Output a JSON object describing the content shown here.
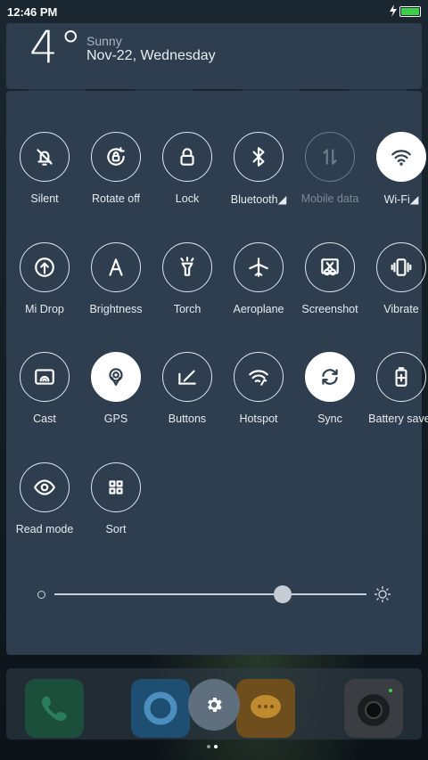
{
  "status": {
    "time": "12:46 PM",
    "battery_color": "#3ecf4a"
  },
  "weather": {
    "temp": "4°",
    "condition": "Sunny",
    "date": "Nov-22, Wednesday"
  },
  "toggles": [
    {
      "label": "Silent",
      "icon": "bell-off-icon",
      "state": "off"
    },
    {
      "label": "Rotate off",
      "icon": "rotate-lock-icon",
      "state": "off"
    },
    {
      "label": "Lock",
      "icon": "lock-icon",
      "state": "off"
    },
    {
      "label": "Bluetooth◢",
      "icon": "bluetooth-icon",
      "state": "off"
    },
    {
      "label": "Mobile data",
      "icon": "mobile-data-icon",
      "state": "disabled"
    },
    {
      "label": "Wi-Fi◢",
      "icon": "wifi-icon",
      "state": "on"
    },
    {
      "label": "Mi Drop",
      "icon": "mi-drop-icon",
      "state": "off"
    },
    {
      "label": "Brightness",
      "icon": "brightness-icon",
      "state": "off"
    },
    {
      "label": "Torch",
      "icon": "torch-icon",
      "state": "off"
    },
    {
      "label": "Aeroplane",
      "icon": "airplane-icon",
      "state": "off"
    },
    {
      "label": "Screenshot",
      "icon": "scissors-icon",
      "state": "off"
    },
    {
      "label": "Vibrate",
      "icon": "vibrate-icon",
      "state": "off"
    },
    {
      "label": "Cast",
      "icon": "cast-icon",
      "state": "off"
    },
    {
      "label": "GPS",
      "icon": "gps-icon",
      "state": "on"
    },
    {
      "label": "Buttons",
      "icon": "buttons-icon",
      "state": "off"
    },
    {
      "label": "Hotspot",
      "icon": "hotspot-icon",
      "state": "off"
    },
    {
      "label": "Sync",
      "icon": "sync-icon",
      "state": "on"
    },
    {
      "label": "Battery saver",
      "icon": "battery-saver-icon",
      "state": "off"
    },
    {
      "label": "Read mode",
      "icon": "eye-icon",
      "state": "off"
    },
    {
      "label": "Sort",
      "icon": "grid-icon",
      "state": "off"
    }
  ],
  "brightness": {
    "level": 0.73
  },
  "dock": {
    "apps": [
      "phone-icon",
      "browser-icon",
      "settings-icon",
      "messages-icon",
      "camera-icon"
    ]
  }
}
